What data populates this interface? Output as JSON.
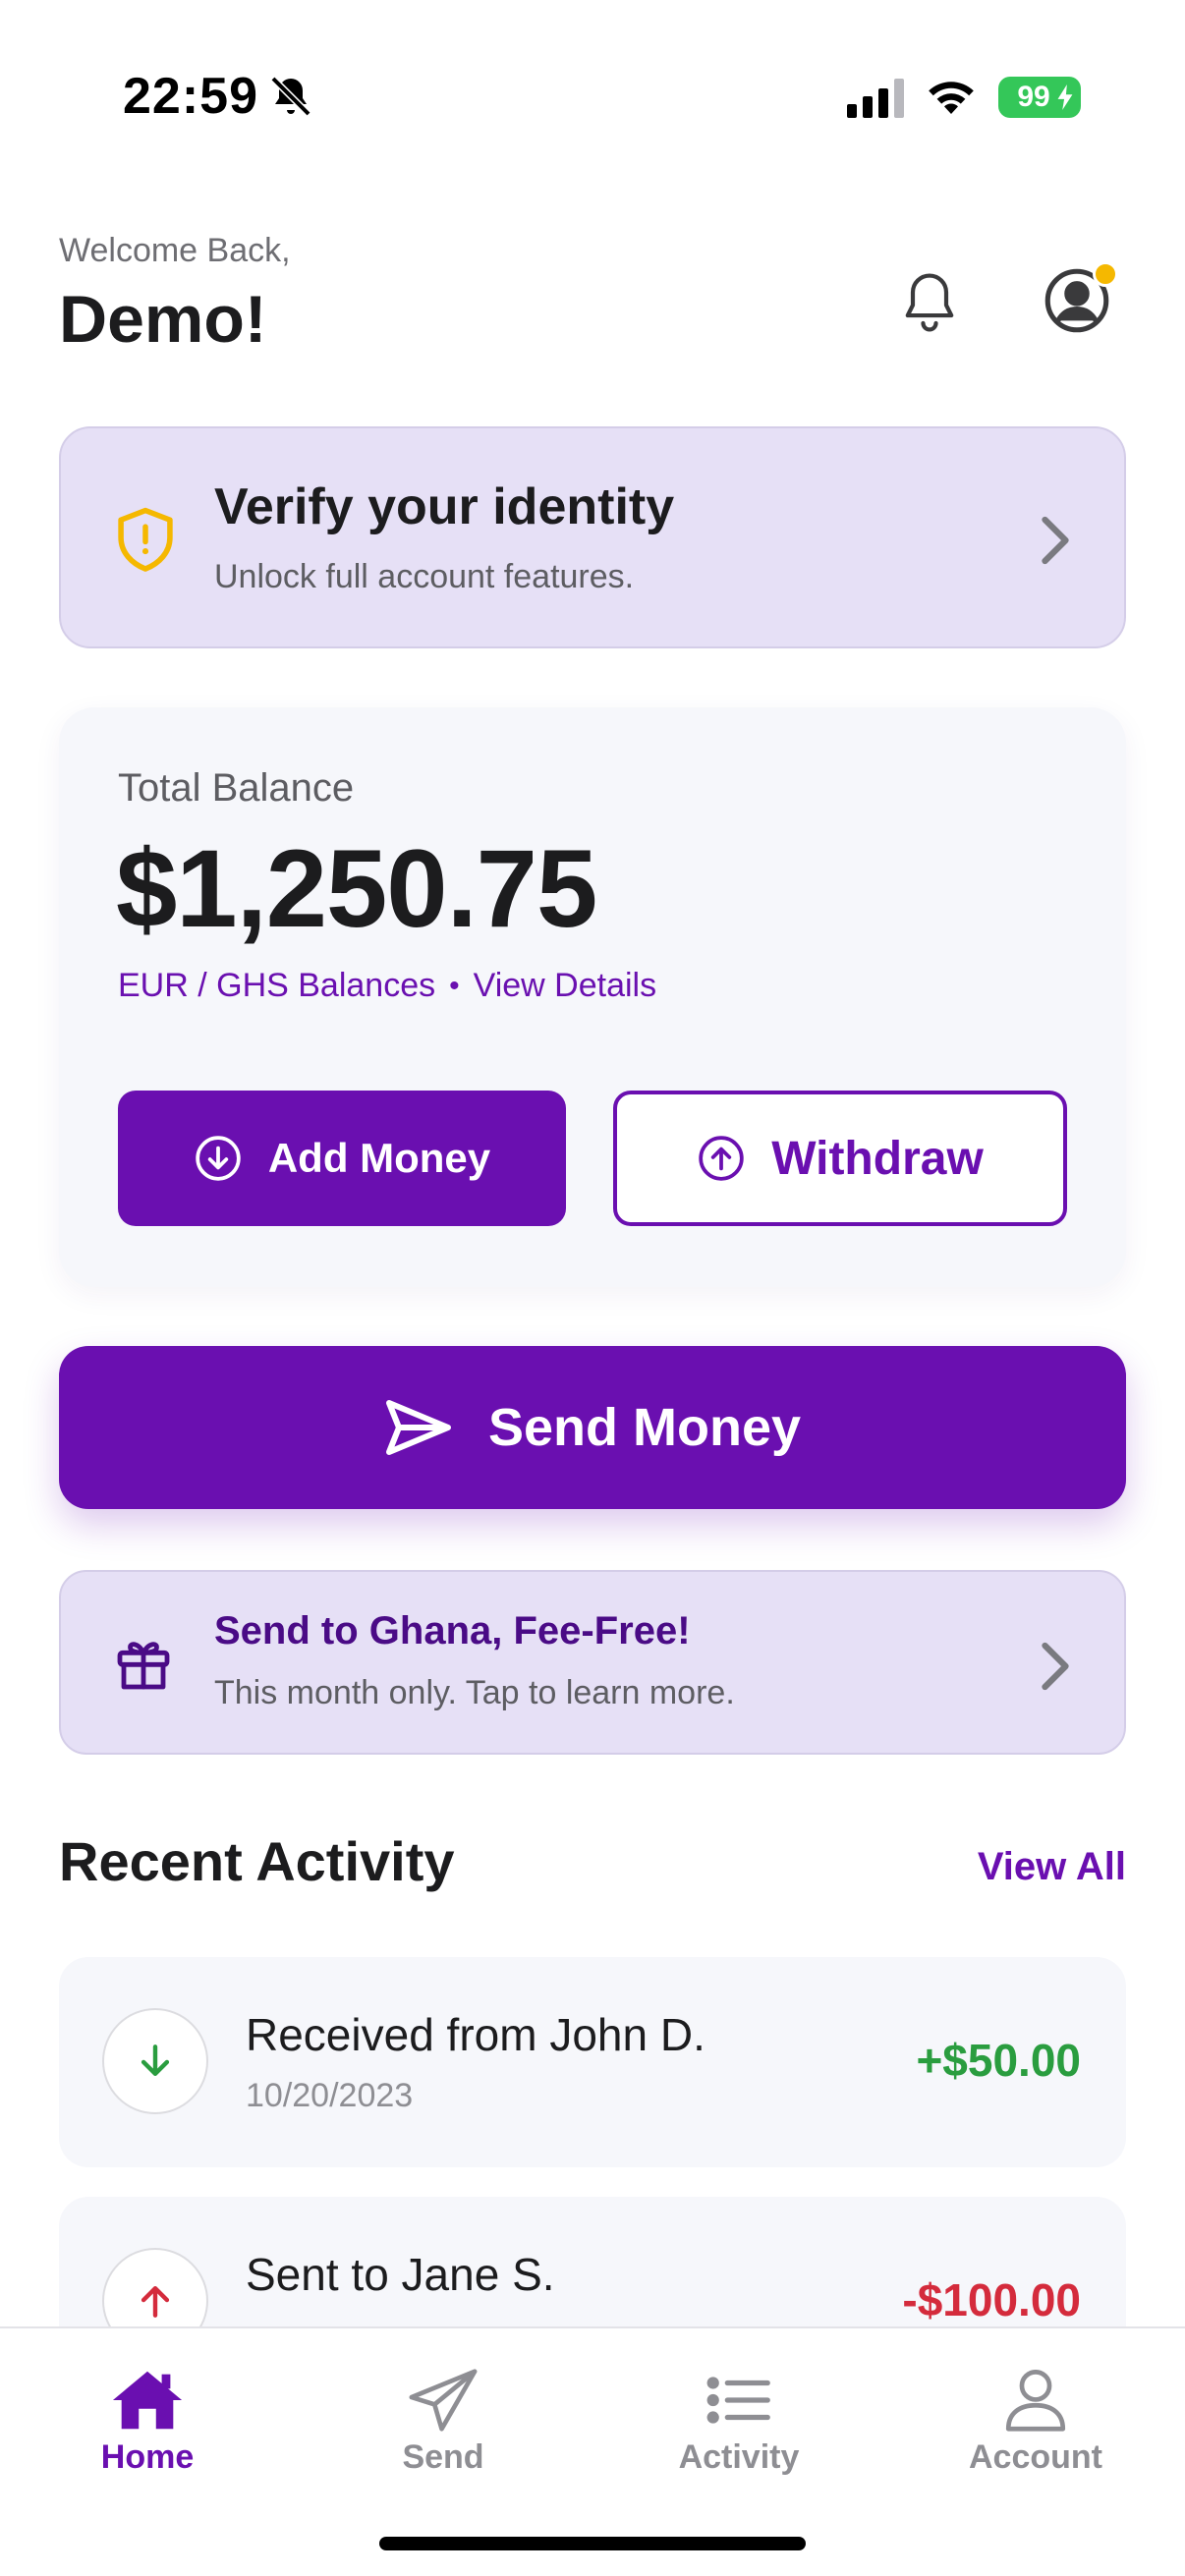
{
  "status_bar": {
    "time": "22:59",
    "battery": "99"
  },
  "header": {
    "welcome": "Welcome Back,",
    "username": "Demo!"
  },
  "verify_card": {
    "title": "Verify your identity",
    "subtitle": "Unlock full account features."
  },
  "balance": {
    "label": "Total Balance",
    "amount": "$1,250.75",
    "links": {
      "balances": "EUR / GHS Balances",
      "separator": "•",
      "details": "View Details"
    },
    "add_label": "Add Money",
    "withdraw_label": "Withdraw"
  },
  "send_money": {
    "label": "Send Money"
  },
  "promo": {
    "title": "Send to Ghana, Fee-Free!",
    "subtitle": "This month only. Tap to learn more."
  },
  "recent": {
    "title": "Recent Activity",
    "view_all": "View All",
    "transactions": [
      {
        "title": "Received from John D.",
        "date": "10/20/2023",
        "amount": "+$50.00",
        "direction": "in"
      },
      {
        "title": "Sent to Jane S.",
        "amount": "-$100.00",
        "direction": "out"
      }
    ]
  },
  "tabs": [
    {
      "label": "Home",
      "icon": "home-icon",
      "active": true
    },
    {
      "label": "Send",
      "icon": "paper-plane-icon"
    },
    {
      "label": "Activity",
      "icon": "list-icon"
    },
    {
      "label": "Account",
      "icon": "person-icon"
    }
  ],
  "colors": {
    "accent": "#6a0fb0",
    "card_tint": "#e6e0f6",
    "positive": "#2a9d3f",
    "negative": "#d42b3c",
    "warning": "#f5b800"
  }
}
